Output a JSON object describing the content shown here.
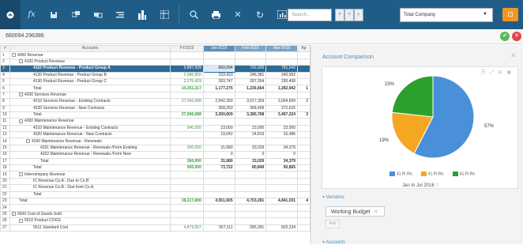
{
  "toolbar": {
    "icons": [
      "dashboard-icon",
      "fx-icon",
      "save-icon",
      "copy-icon",
      "copy2-icon",
      "indent-icon",
      "report-icon",
      "grid-icon",
      "zoom-icon",
      "print-icon",
      "close-icon",
      "refresh-icon",
      "chart-icon"
    ],
    "search_placeholder": "Search...",
    "company": "Total Company"
  },
  "formula": {
    "value": "660094.296386"
  },
  "grid": {
    "headers": [
      "#",
      "Accounts",
      "FY2015",
      "Jan-2016",
      "Feb-2016",
      "Mar-2016",
      "Ap"
    ],
    "rows": [
      {
        "n": "1",
        "indent": 0,
        "box": "−",
        "label": "4000 Revenue",
        "fy": "",
        "jan": "",
        "feb": "",
        "mar": "",
        "ap": ""
      },
      {
        "n": "2",
        "indent": 1,
        "box": "−",
        "label": "4100 Product Revenue",
        "fy": "",
        "jan": "",
        "feb": "",
        "mar": "",
        "ap": ""
      },
      {
        "n": "3",
        "indent": 3,
        "box": "",
        "label": "4110 Product Revenue - Product Group A",
        "fy": "5,887,939",
        "jan": "660,094",
        "feb": "702,929",
        "mar": "751,542",
        "ap": "",
        "sel": true
      },
      {
        "n": "4",
        "indent": 3,
        "box": "",
        "label": "4120 Product Revenue - Product Group B",
        "fy": "2,086,850",
        "jan": "233,433",
        "feb": "246,381",
        "mar": "240,992",
        "ap": ""
      },
      {
        "n": "5",
        "indent": 3,
        "box": "",
        "label": "4130 Product Revenue - Product Group C",
        "fy": "2,276,429",
        "jan": "283,747",
        "feb": "287,354",
        "mar": "290,408",
        "ap": ""
      },
      {
        "n": "6",
        "indent": 3,
        "box": "",
        "label": "Total",
        "fy": "10,251,217",
        "jan": "1,177,275",
        "feb": "1,236,664",
        "mar": "1,282,942",
        "ap": "1",
        "bold": true
      },
      {
        "n": "7",
        "indent": 1,
        "box": "−",
        "label": "4200 Services Revenue",
        "fy": "",
        "jan": "",
        "feb": "",
        "mar": "",
        "ap": ""
      },
      {
        "n": "8",
        "indent": 3,
        "box": "",
        "label": "4210 Services Revenue - Existing Contracts",
        "fy": "27,066,588",
        "jan": "2,942,359",
        "feb": "3,017,359",
        "mar": "3,094,609",
        "ap": "3"
      },
      {
        "n": "9",
        "indent": 3,
        "box": "",
        "label": "4220 Services Revenue - New Contracts",
        "fy": "",
        "jan": "358,250",
        "feb": "368,409",
        "mar": "372,615",
        "ap": ""
      },
      {
        "n": "10",
        "indent": 3,
        "box": "",
        "label": "Total",
        "fy": "27,066,588",
        "jan": "3,300,609",
        "feb": "3,385,768",
        "mar": "3,467,224",
        "ap": "3",
        "bold": true
      },
      {
        "n": "11",
        "indent": 1,
        "box": "−",
        "label": "4300 Maintenance Revenue",
        "fy": "",
        "jan": "",
        "feb": "",
        "mar": "",
        "ap": ""
      },
      {
        "n": "12",
        "indent": 3,
        "box": "",
        "label": "4310 Maintenance Revenue - Existing Contracts",
        "fy": "540,000",
        "jan": "23,000",
        "feb": "23,000",
        "mar": "23,000",
        "ap": ""
      },
      {
        "n": "13",
        "indent": 3,
        "box": "",
        "label": "4320 Maintenance Revenue - New Contracts",
        "fy": "",
        "jan": "19,042",
        "feb": "24,819",
        "mar": "33,486",
        "ap": ""
      },
      {
        "n": "14",
        "indent": 2,
        "box": "−",
        "label": "4330 Maintenance Revenue - Renewals",
        "fy": "",
        "jan": "",
        "feb": "",
        "mar": "",
        "ap": ""
      },
      {
        "n": "15",
        "indent": 4,
        "box": "",
        "label": "4331 Maintenance Revenue - Renewals /From Existing",
        "fy": "360,000",
        "jan": "31,680",
        "feb": "33,029",
        "mar": "34,379",
        "ap": ""
      },
      {
        "n": "16",
        "indent": 4,
        "box": "",
        "label": "4332 Maintenance Revenue - Renewals /From New",
        "fy": "",
        "jan": "0",
        "feb": "0",
        "mar": "0",
        "ap": ""
      },
      {
        "n": "17",
        "indent": 4,
        "box": "",
        "label": "Total",
        "fy": "360,000",
        "jan": "31,680",
        "feb": "33,029",
        "mar": "34,379",
        "ap": "",
        "bold": true
      },
      {
        "n": "18",
        "indent": 3,
        "box": "",
        "label": "Total",
        "fy": "900,000",
        "jan": "73,722",
        "feb": "80,849",
        "mar": "90,865",
        "ap": "",
        "bold": true
      },
      {
        "n": "19",
        "indent": 1,
        "box": "−",
        "label": "Intercompany Revenue",
        "fy": "",
        "jan": "",
        "feb": "",
        "mar": "",
        "ap": ""
      },
      {
        "n": "20",
        "indent": 3,
        "box": "",
        "label": "IC Revenue Co.A - Due to Co.B",
        "fy": "",
        "jan": "",
        "feb": "",
        "mar": "",
        "ap": ""
      },
      {
        "n": "21",
        "indent": 3,
        "box": "",
        "label": "IC Revenue Co.B - Due from Co.A",
        "fy": "",
        "jan": "",
        "feb": "",
        "mar": "",
        "ap": ""
      },
      {
        "n": "22",
        "indent": 3,
        "box": "",
        "label": "Total",
        "fy": "",
        "jan": "",
        "feb": "",
        "mar": "",
        "ap": "",
        "bold": true
      },
      {
        "n": "23",
        "indent": 1,
        "box": "",
        "label": "Total",
        "fy": "38,217,800",
        "jan": "4,551,605",
        "feb": "4,703,281",
        "mar": "4,841,031",
        "ap": "4",
        "bold": true
      },
      {
        "n": "24",
        "indent": 0,
        "box": "",
        "label": "",
        "fy": "",
        "jan": "",
        "feb": "",
        "mar": "",
        "ap": ""
      },
      {
        "n": "25",
        "indent": 0,
        "box": "−",
        "label": "5500 Cost of Goods Sold",
        "fy": "",
        "jan": "",
        "feb": "",
        "mar": "",
        "ap": ""
      },
      {
        "n": "26",
        "indent": 1,
        "box": "−",
        "label": "5510 Product COGS",
        "fy": "",
        "jan": "",
        "feb": "",
        "mar": "",
        "ap": ""
      },
      {
        "n": "27",
        "indent": 3,
        "box": "",
        "label": "5511 Standard Cost",
        "fy": "4,879,657",
        "jan": "557,111",
        "feb": "585,391",
        "mar": "602,234",
        "ap": ""
      }
    ]
  },
  "panel": {
    "title": "Account Comparison",
    "chart_data": {
      "type": "pie",
      "values": [
        57,
        19,
        23
      ],
      "labels": [
        "57%",
        "19%",
        "23%"
      ],
      "colors": [
        "#4a90d9",
        "#f5a623",
        "#2ca02c"
      ],
      "legend": [
        "41.Pr.Re.",
        "41.Pr.Re.",
        "41.Pr.Re."
      ]
    },
    "date_range": "Jan to Jul 2016",
    "versions_label": "Versions",
    "version_tag": "Working Budget",
    "add_label": "Add",
    "accounts_label": "Accounts"
  }
}
